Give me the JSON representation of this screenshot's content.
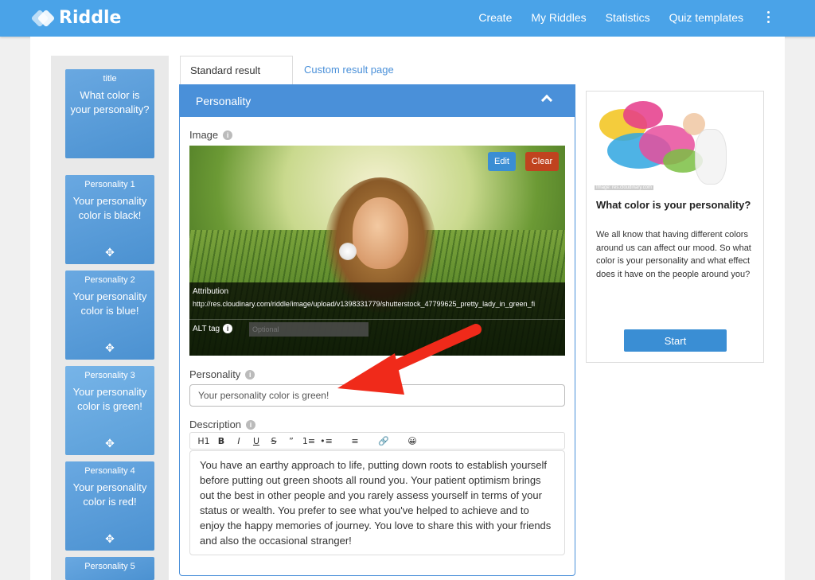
{
  "app": {
    "name": "Riddle"
  },
  "nav": {
    "items": [
      "Create",
      "My Riddles",
      "Statistics",
      "Quiz templates"
    ]
  },
  "sidebar": {
    "cards": [
      {
        "label": "title",
        "text": "What color is your personality?"
      },
      {
        "label": "Personality 1",
        "text": "Your personality color is black!"
      },
      {
        "label": "Personality 2",
        "text": "Your personality color is blue!"
      },
      {
        "label": "Personality 3",
        "text": "Your personality color is green!"
      },
      {
        "label": "Personality 4",
        "text": "Your personality color is red!"
      },
      {
        "label": "Personality 5",
        "text": ""
      }
    ]
  },
  "tabs": {
    "standard": "Standard result page",
    "custom": "Custom result page"
  },
  "panel": {
    "header": "Personality",
    "image_label": "Image",
    "edit_label": "Edit",
    "clear_label": "Clear",
    "attribution_label": "Attribution",
    "attribution_url": "http://res.cloudinary.com/riddle/image/upload/v1398331779/shutterstock_47799625_pretty_lady_in_green_fi",
    "alt_label": "ALT tag",
    "alt_placeholder": "Optional",
    "personality_label": "Personality",
    "personality_value": "Your personality color is green!",
    "description_label": "Description",
    "description_text": "You have an earthy approach to life, putting down roots to establish yourself before putting out green shoots all round you. Your patient optimism brings out the best in other people and you rarely assess yourself in terms of your status or wealth. You prefer to see what you've helped to achieve and to enjoy the happy memories of journey. You love to share this with your friends and also the occasional stranger!"
  },
  "toolbar": {
    "buttons": [
      "H1",
      "B",
      "I",
      "U",
      "S",
      "”",
      "1≡",
      "•≡",
      "≡",
      "link-icon",
      "emoji-icon"
    ]
  },
  "preview": {
    "credit": "Image: res.cloudinary.com",
    "title": "What color is your personality?",
    "description": "We all know that having different colors around us can affect our mood. So what color is your personality and what effect does it have on the people around you?",
    "start_label": "Start"
  },
  "colors": {
    "brand": "#4aa3e8",
    "accent": "#4a90d9",
    "danger": "#c0431f",
    "arrow": "#f02a1a"
  }
}
